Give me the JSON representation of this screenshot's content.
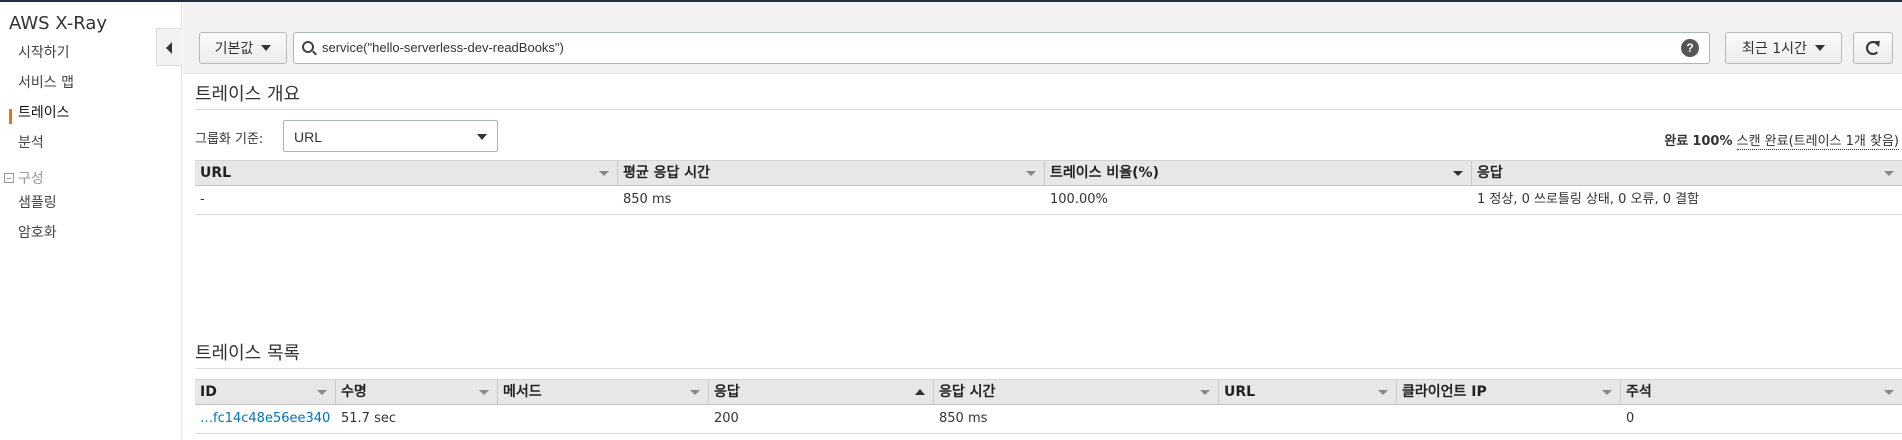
{
  "app": {
    "title": "AWS X-Ray"
  },
  "sidebar": {
    "items": [
      {
        "label": "시작하기"
      },
      {
        "label": "서비스 맵"
      },
      {
        "label": "트레이스"
      },
      {
        "label": "분석"
      }
    ],
    "group": {
      "label": "구성"
    },
    "sub_items": [
      {
        "label": "샘플링"
      },
      {
        "label": "암호화"
      }
    ]
  },
  "toolbar": {
    "default_label": "기본값",
    "search_value": "service(\"hello-serverless-dev-readBooks\")",
    "help_label": "?",
    "time_label": "최근 1시간"
  },
  "overview": {
    "title": "트레이스 개요",
    "groupby_label": "그룹화 기준:",
    "groupby_value": "URL",
    "status": {
      "prefix": "완료",
      "percent": "100%",
      "detail": "스캔 완료(트레이스 1개 찾음)"
    },
    "columns": [
      "URL",
      "평균 응답 시간",
      "트레이스 비율(%)",
      "응답"
    ],
    "rows": [
      {
        "url": "-",
        "avg": "850 ms",
        "ratio": "100.00%",
        "response": "1 정상, 0 쓰로틀링 상태, 0 오류, 0 결함"
      }
    ]
  },
  "traces": {
    "title": "트레이스 목록",
    "columns": [
      "ID",
      "수명",
      "메서드",
      "응답",
      "응답 시간",
      "URL",
      "클라이언트 IP",
      "주석"
    ],
    "rows": [
      {
        "id": "…fc14c48e56ee340",
        "age": "51.7 sec",
        "method": "",
        "response": "200",
        "response_time": "850 ms",
        "url": "",
        "client_ip": "",
        "annotations": "0"
      }
    ]
  },
  "colors": {
    "accent": "#ec7211",
    "link": "#0073bb",
    "header_bg": "#e7e7e7"
  }
}
